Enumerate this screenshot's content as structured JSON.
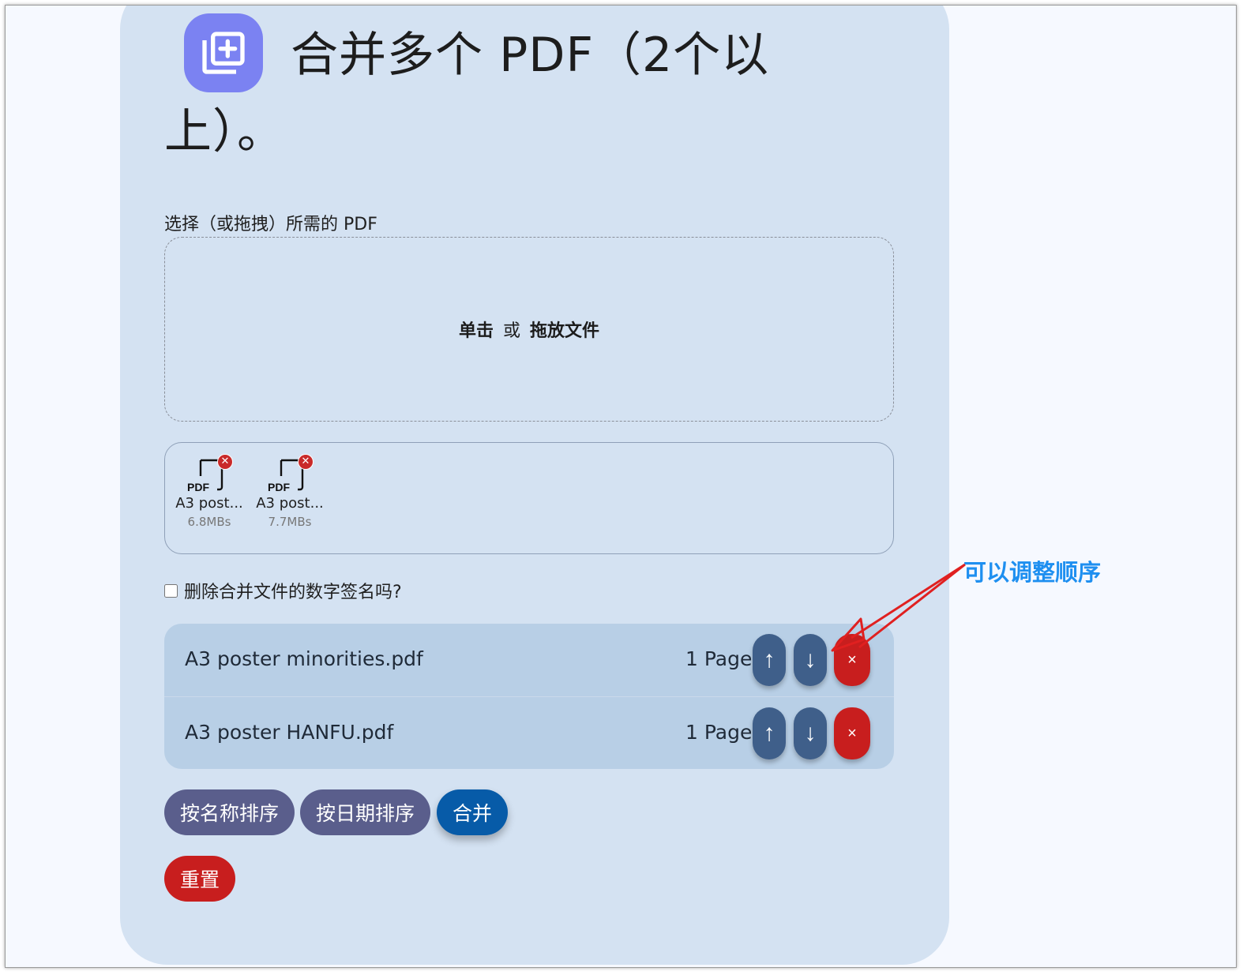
{
  "title": {
    "line1": "合并多个 PDF（2个以",
    "line2": "上）。",
    "icon": "library-add-icon"
  },
  "select_label": "选择（或拖拽）所需的 PDF",
  "dropzone": {
    "click": "单击",
    "or": "或",
    "drag": "拖放文件"
  },
  "thumbnails": [
    {
      "type": "PDF",
      "name": "A3 post...",
      "size": "6.8MBs"
    },
    {
      "type": "PDF",
      "name": "A3 post...",
      "size": "7.7MBs"
    }
  ],
  "remove_signature_label": "删除合并文件的数字签名吗?",
  "files": [
    {
      "name": "A3 poster minorities.pdf",
      "pages": "1 Page"
    },
    {
      "name": "A3 poster HANFU.pdf",
      "pages": "1 Page"
    }
  ],
  "row_buttons": {
    "up": "↑",
    "down": "↓",
    "remove": "×"
  },
  "actions": {
    "sort_name": "按名称排序",
    "sort_date": "按日期排序",
    "merge": "合并",
    "reset": "重置"
  },
  "annotation": "可以调整顺序",
  "colors": {
    "card": "#d4e2f2",
    "icon_bg": "#7b82f2",
    "row_button": "#3f5f8a",
    "danger": "#c81e1e",
    "merge": "#075ba8",
    "annotation": "#1e8ff0",
    "arrow": "#e02020"
  }
}
